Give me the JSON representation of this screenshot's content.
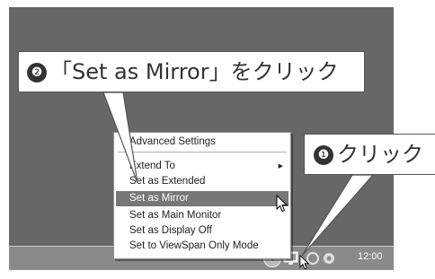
{
  "callouts": {
    "main": {
      "badge": "❷",
      "text": "「Set as Mirror」をクリック"
    },
    "click": {
      "badge": "❶",
      "text": "クリック"
    }
  },
  "menu": {
    "items": [
      {
        "label": "Advanced Settings"
      },
      {
        "label": "Extend To",
        "submenu_arrow": "▶"
      },
      {
        "label": "Set as Extended"
      },
      {
        "label": "Set as Mirror"
      },
      {
        "label": "Set as Main Monitor"
      },
      {
        "label": "Set as Display Off"
      },
      {
        "label": "Set to ViewSpan Only Mode"
      }
    ]
  },
  "taskbar": {
    "chevron": "‹",
    "clock": "12:00"
  },
  "colors": {
    "desktop": "#676767",
    "selection": "#777777",
    "taskbar": "#8a8a8a"
  }
}
